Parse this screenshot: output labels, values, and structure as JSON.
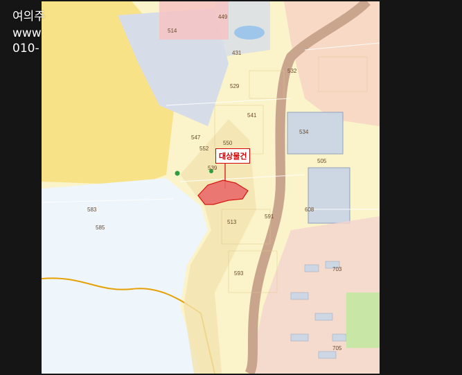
{
  "overlay": {
    "line1": "여의주",
    "line2": "www",
    "line3": "010-"
  },
  "target": {
    "label": "대상물건",
    "color": "#d40000"
  },
  "map_labels": [
    {
      "id": "514",
      "text": "514"
    },
    {
      "id": "449",
      "text": "449"
    },
    {
      "id": "431",
      "text": "431"
    },
    {
      "id": "532",
      "text": "532"
    },
    {
      "id": "529",
      "text": "529"
    },
    {
      "id": "541",
      "text": "541"
    },
    {
      "id": "547",
      "text": "547"
    },
    {
      "id": "552",
      "text": "552"
    },
    {
      "id": "534",
      "text": "534"
    },
    {
      "id": "505",
      "text": "505"
    },
    {
      "id": "550",
      "text": "550"
    },
    {
      "id": "539",
      "text": "539"
    },
    {
      "id": "513",
      "text": "513"
    },
    {
      "id": "593",
      "text": "593"
    },
    {
      "id": "608",
      "text": "608"
    },
    {
      "id": "703",
      "text": "703"
    },
    {
      "id": "705",
      "text": "705"
    },
    {
      "id": "591",
      "text": "591"
    },
    {
      "id": "583",
      "text": "583"
    },
    {
      "id": "585",
      "text": "585"
    }
  ],
  "colors": {
    "residential": "#fbf3c9",
    "commercial": "#f6c3c3",
    "industrial": "#d7dde8",
    "water": "#e9f2fb",
    "road": "#c8a58c",
    "green": "#c8e6a6"
  }
}
